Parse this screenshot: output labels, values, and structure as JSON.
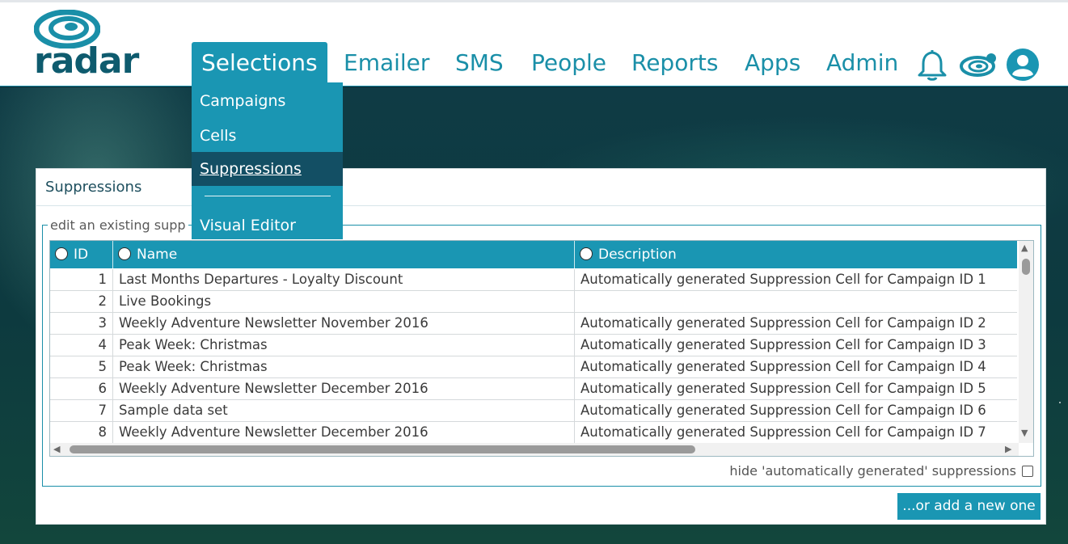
{
  "brand": {
    "logo_text": "radar",
    "accent": "#1a96b3",
    "dark_accent": "#134f64"
  },
  "nav": {
    "items": [
      {
        "label": "Selections"
      },
      {
        "label": "Emailer"
      },
      {
        "label": "SMS"
      },
      {
        "label": "People"
      },
      {
        "label": "Reports"
      },
      {
        "label": "Apps"
      },
      {
        "label": "Admin"
      }
    ],
    "icons": [
      "bell-icon",
      "radar-icon",
      "user-avatar-icon"
    ]
  },
  "dropdown": {
    "items": [
      {
        "label": "Campaigns"
      },
      {
        "label": "Cells"
      },
      {
        "label": "Suppressions"
      },
      {
        "label": "Visual Editor"
      }
    ]
  },
  "panel": {
    "title": "Suppressions",
    "legend": "edit an existing supp",
    "hide_label": "hide 'automatically generated' suppressions",
    "add_button": "...or add a new one"
  },
  "table": {
    "headers": [
      "ID",
      "Name",
      "Description"
    ],
    "rows": [
      {
        "id": "1",
        "name": "Last Months Departures - Loyalty Discount",
        "desc": "Automatically generated Suppression Cell for Campaign ID 1"
      },
      {
        "id": "2",
        "name": "Live Bookings",
        "desc": ""
      },
      {
        "id": "3",
        "name": "Weekly Adventure Newsletter November 2016",
        "desc": "Automatically generated Suppression Cell for Campaign ID 2"
      },
      {
        "id": "4",
        "name": "Peak Week: Christmas",
        "desc": "Automatically generated Suppression Cell for Campaign ID 3"
      },
      {
        "id": "5",
        "name": "Peak Week: Christmas",
        "desc": "Automatically generated Suppression Cell for Campaign ID 4"
      },
      {
        "id": "6",
        "name": "Weekly Adventure Newsletter December 2016",
        "desc": "Automatically generated Suppression Cell for Campaign ID 5"
      },
      {
        "id": "7",
        "name": "Sample data set",
        "desc": "Automatically generated Suppression Cell for Campaign ID 6"
      },
      {
        "id": "8",
        "name": "Weekly Adventure Newsletter December 2016",
        "desc": "Automatically generated Suppression Cell for Campaign ID 7"
      }
    ]
  }
}
